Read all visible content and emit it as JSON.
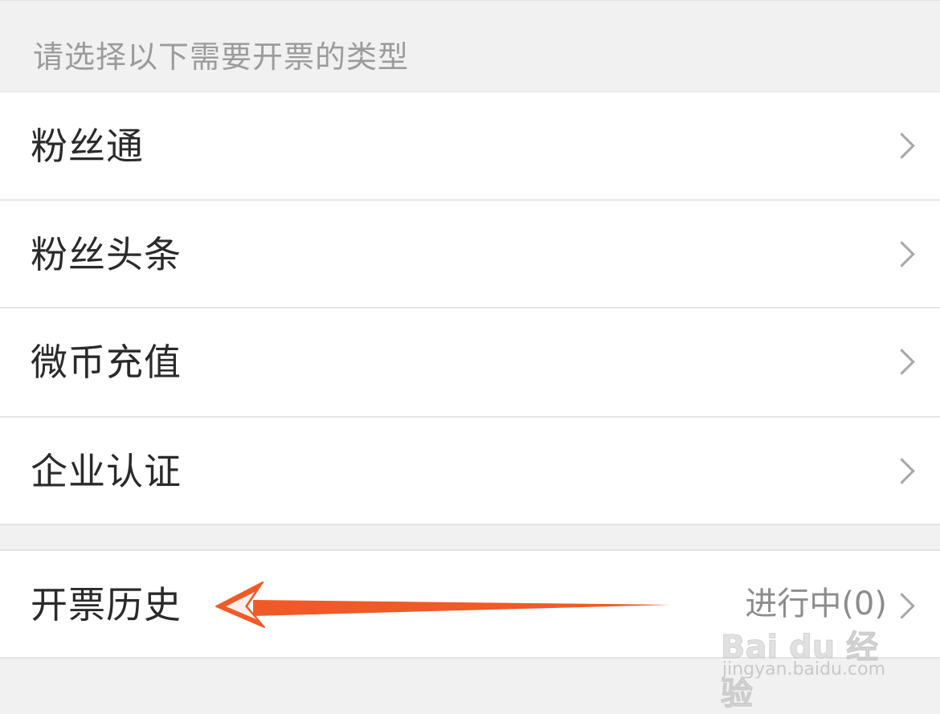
{
  "header": {
    "hint": "请选择以下需要开票的类型"
  },
  "invoice_types": [
    {
      "label": "粉丝通"
    },
    {
      "label": "粉丝头条"
    },
    {
      "label": "微币充值"
    },
    {
      "label": "企业认证"
    }
  ],
  "history": {
    "label": "开票历史",
    "status": "进行中(0)"
  },
  "annotation": {
    "arrow_color": "#f05a28"
  },
  "watermark": {
    "brand": "Bai du 经验",
    "url": "jingyan.baidu.com"
  },
  "colors": {
    "background": "#f1f1f1",
    "row_background": "#ffffff",
    "primary_text": "#2a2a2a",
    "secondary_text": "#9b9b9b",
    "chevron": "#a7a7a7"
  }
}
